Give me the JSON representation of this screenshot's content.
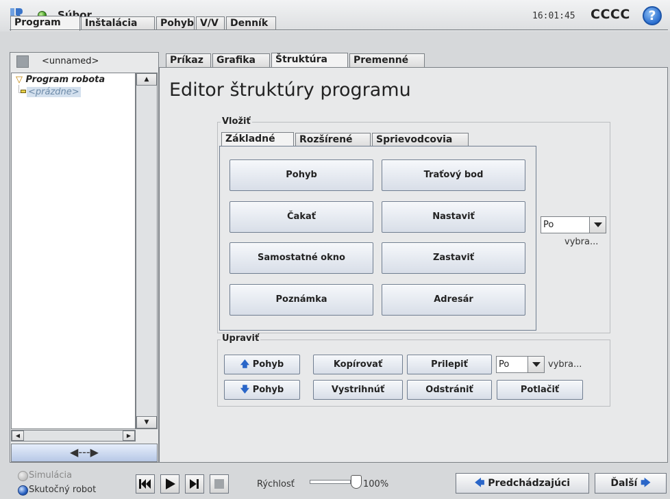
{
  "header": {
    "file_label": "Súbor",
    "clock": "16:01:45",
    "robot_name": "CCCC",
    "help": "?"
  },
  "top_tabs": [
    "Program",
    "Inštalácia",
    "Pohyb",
    "V/V",
    "Denník"
  ],
  "left": {
    "program_name": "<unnamed>",
    "tree_root": "Program robota",
    "tree_child": "<prázdne>",
    "drag_label": "◀---▶"
  },
  "sub_tabs": [
    "Príkaz",
    "Grafika",
    "Štruktúra",
    "Premenné"
  ],
  "main": {
    "title": "Editor štruktúry programu",
    "insert_label": "Vložiť",
    "insert_tabs": [
      "Základné",
      "Rozšírené",
      "Sprievodcovia"
    ],
    "insert_buttons": [
      "Pohyb",
      "Traťový bod",
      "Čakať",
      "Nastaviť",
      "Samostatné okno",
      "Zastaviť",
      "Poznámka",
      "Adresár"
    ],
    "insert_dropdown": "Po",
    "insert_dropdown_hint": "vybra...",
    "edit_label": "Upraviť",
    "move_up": "Pohyb",
    "move_down": "Pohyb",
    "copy": "Kopírovať",
    "paste": "Prilepiť",
    "cut": "Vystrihnúť",
    "delete": "Odstrániť",
    "suppress": "Potlačiť",
    "edit_dropdown": "Po",
    "edit_dropdown_hint": "vybra..."
  },
  "footer": {
    "simulation": "Simulácia",
    "real_robot": "Skutočný robot",
    "speed_label": "Rýchlosť",
    "speed_value": "100%",
    "speed_fraction": 1.0,
    "prev": "Predchádzajúci",
    "next": "Ďalší"
  }
}
